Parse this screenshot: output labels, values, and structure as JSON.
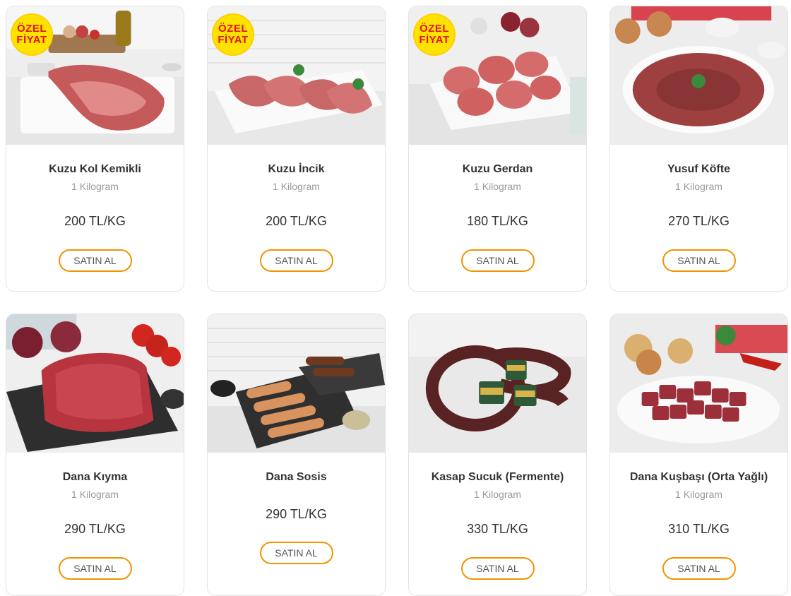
{
  "colors": {
    "accent": "#f39200",
    "badge_bg": "#ffe200",
    "badge_text": "#e3121b",
    "title": "#333333",
    "muted": "#9a9a9a"
  },
  "products": [
    {
      "name": "Kuzu Kol Kemikli",
      "unit": "1 Kilogram",
      "price": "200 TL/KG",
      "button": "SATIN AL",
      "badge": "ÖZEL FİYAT",
      "image": "lamb-shoulder"
    },
    {
      "name": "Kuzu İncik",
      "unit": "1 Kilogram",
      "price": "200 TL/KG",
      "button": "SATIN AL",
      "badge": "ÖZEL FİYAT",
      "image": "lamb-shank"
    },
    {
      "name": "Kuzu Gerdan",
      "unit": "1 Kilogram",
      "price": "180 TL/KG",
      "button": "SATIN AL",
      "badge": "ÖZEL FİYAT",
      "image": "lamb-neck"
    },
    {
      "name": "Yusuf Köfte",
      "unit": "1 Kilogram",
      "price": "270 TL/KG",
      "button": "SATIN AL",
      "image": "meatballs"
    },
    {
      "name": "Dana Kıyma",
      "unit": "1 Kilogram",
      "price": "290 TL/KG",
      "button": "SATIN AL",
      "image": "ground-beef"
    },
    {
      "name": "Dana Sosis",
      "price": "290 TL/KG",
      "button": "SATIN AL",
      "image": "beef-sausage"
    },
    {
      "name": "Kasap Sucuk (Fermente)",
      "unit": "1 Kilogram",
      "price": "330 TL/KG",
      "button": "SATIN AL",
      "image": "sucuk"
    },
    {
      "name": "Dana Kuşbaşı (Orta Yağlı)",
      "unit": "1 Kilogram",
      "price": "310 TL/KG",
      "button": "SATIN AL",
      "image": "beef-cubes"
    }
  ]
}
